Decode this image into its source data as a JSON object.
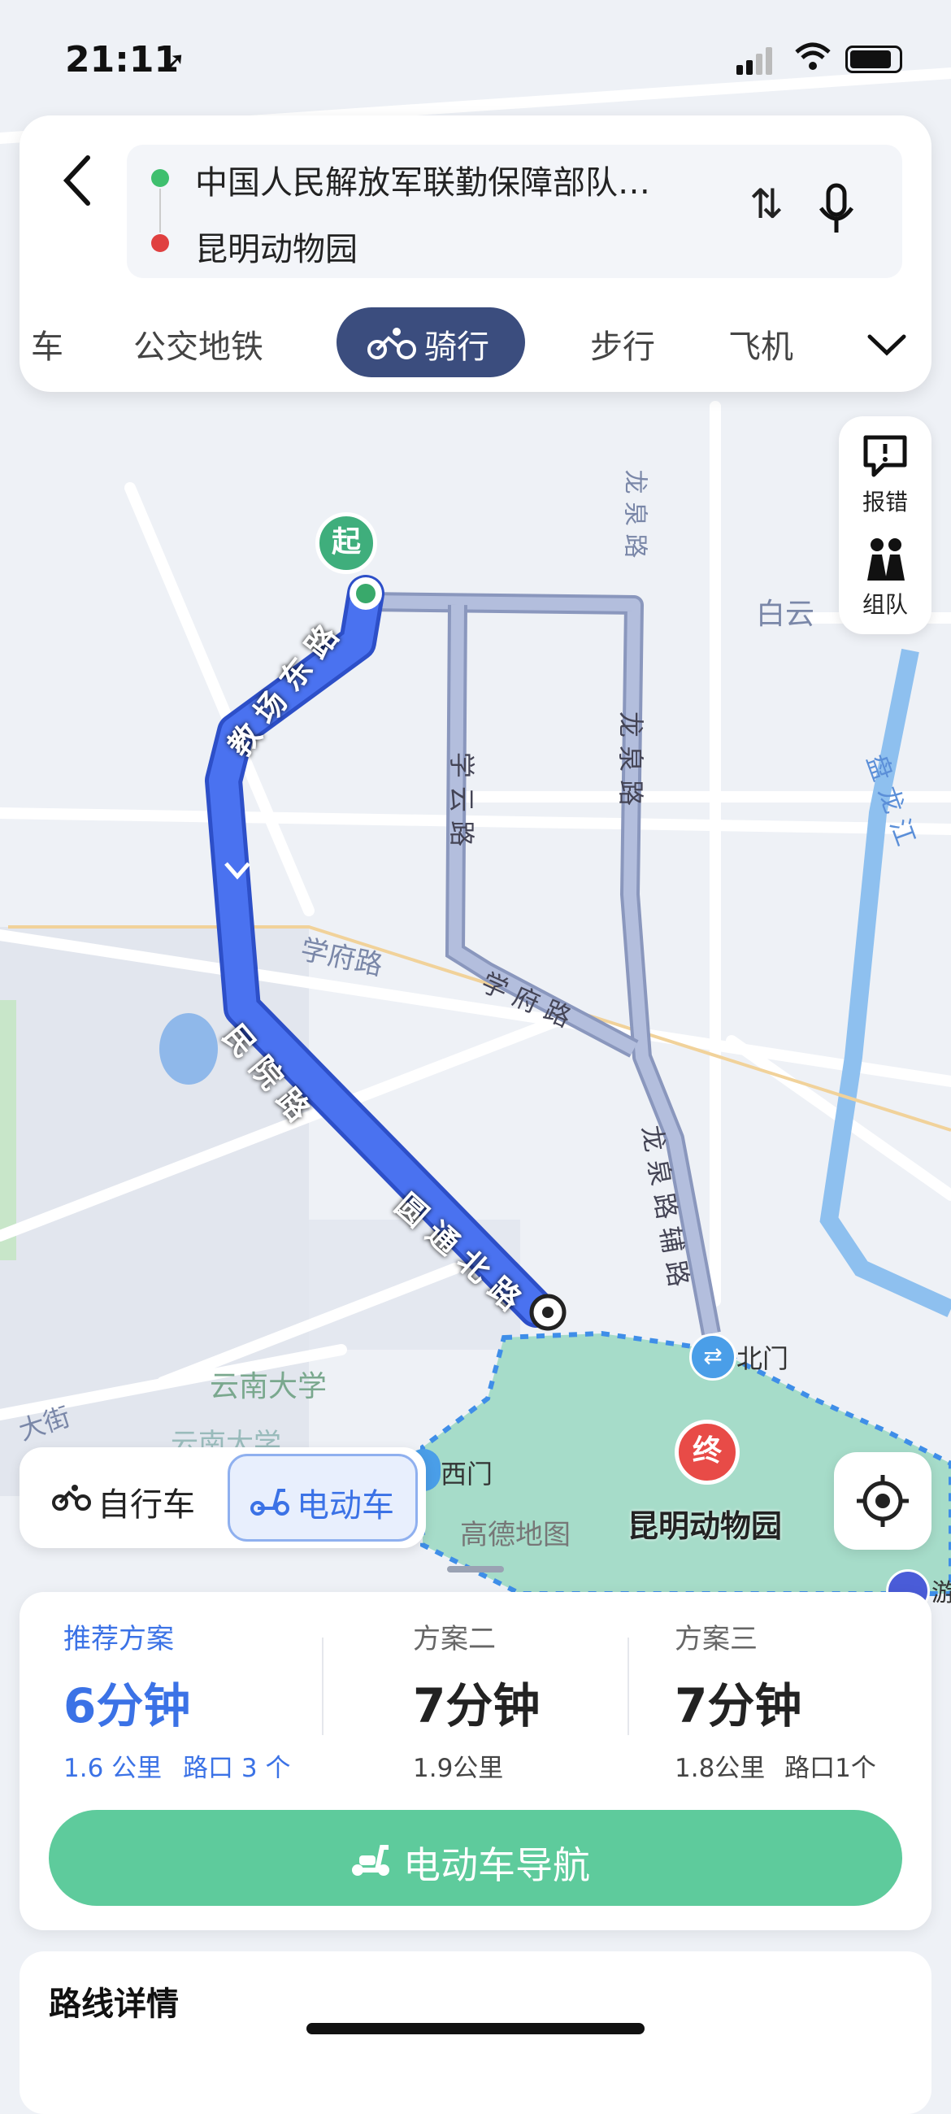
{
  "status_bar": {
    "time": "21:11"
  },
  "route_inputs": {
    "origin": "中国人民解放军联勤保障部队…",
    "destination": "昆明动物园"
  },
  "transport_tabs": {
    "partial_left": "车",
    "transit": "公交地铁",
    "cycling": "骑行",
    "walking": "步行",
    "plane": "飞机"
  },
  "side_buttons": {
    "report": "报错",
    "team": "组队"
  },
  "map": {
    "start_marker": "起",
    "end_marker": "终",
    "labels": {
      "jiaochang_east": "教 场 东 路",
      "minyuan": "民 院 路",
      "yuantong_north": "圆 通 北 路",
      "xueyun": "学 云 路",
      "longquan": "龙 泉 路",
      "longquan_top": "龙 泉 路",
      "xuefu_left": "学府路",
      "xuefu_right": "学 府 路",
      "longquan_aux": "龙 泉 路 辅 路",
      "baiyun": "白云",
      "panlong": "盘 龙 江",
      "yunnan_univ": "云南大学",
      "yunnan_univ2": "云南大学",
      "dajie": "大街",
      "north_gate": "北门",
      "west_gate": "西门",
      "zoo": "昆明动物园",
      "watermark": "高德地图",
      "edge_label": "游"
    }
  },
  "vehicle_toggle": {
    "bicycle": "自行车",
    "ebike": "电动车"
  },
  "route_options": [
    {
      "label": "推荐方案",
      "time": "6分钟",
      "distance": "1.6 公里",
      "crossings": "路口 3 个"
    },
    {
      "label": "方案二",
      "time": "7分钟",
      "distance": "1.9公里",
      "crossings": ""
    },
    {
      "label": "方案三",
      "time": "7分钟",
      "distance": "1.8公里",
      "crossings": "路口1个"
    }
  ],
  "nav_button": "电动车导航",
  "route_details": "路线详情",
  "colors": {
    "route": "#4a72f0",
    "alt_route": "#a9b5d6",
    "accent": "#3b72e6",
    "nav": "#5ecb9c",
    "tab_active": "#3b4d7e"
  }
}
